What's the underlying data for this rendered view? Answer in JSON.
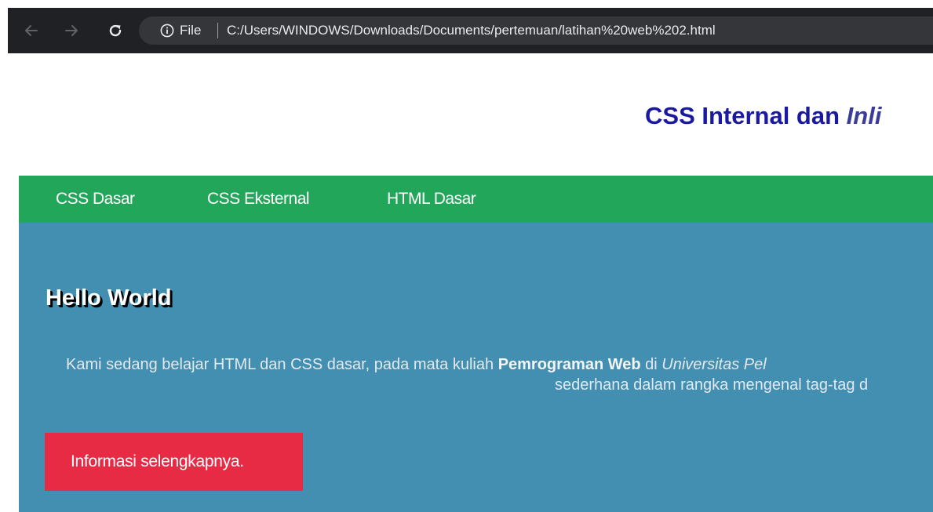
{
  "browser": {
    "scheme_label": "File",
    "url": "C:/Users/WINDOWS/Downloads/Documents/pertemuan/latihan%20web%202.html"
  },
  "page": {
    "title_plain": "CSS Internal dan ",
    "title_italic": "Inli",
    "nav": {
      "items": [
        {
          "label": "CSS Dasar"
        },
        {
          "label": "CSS Eksternal"
        },
        {
          "label": "HTML Dasar"
        }
      ]
    },
    "content": {
      "heading": "Hello World",
      "desc_part1": "Kami sedang belajar HTML dan CSS dasar, pada mata kuliah ",
      "desc_bold": "Pemrograman Web",
      "desc_part2": " di ",
      "desc_italic": "Universitas Pel",
      "desc_line2": "sederhana dalam rangka mengenal tag-tag d",
      "button_label": "Informasi selengkapnya."
    }
  },
  "colors": {
    "toolbar_bg": "#202124",
    "title_color": "#1a1aa0",
    "nav_bg": "#22a65a",
    "content_bg": "#428fb2",
    "button_bg": "#e72b45"
  },
  "icons": {
    "back": "arrow-left-icon",
    "forward": "arrow-right-icon",
    "reload": "reload-icon",
    "info": "info-circle-icon"
  }
}
